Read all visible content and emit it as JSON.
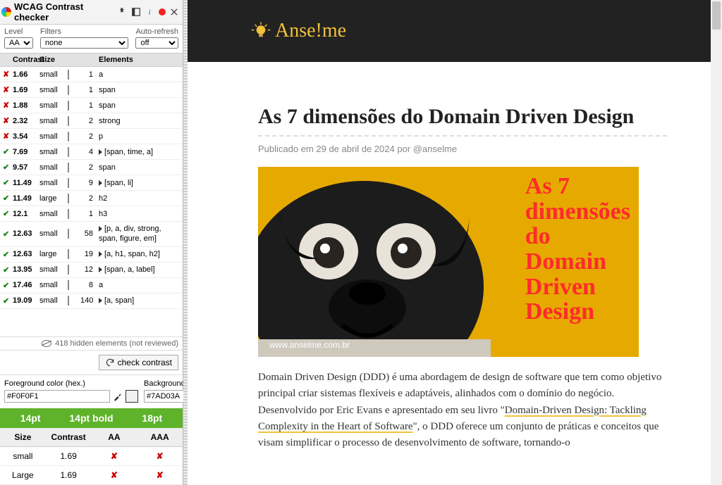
{
  "panel": {
    "title": "WCAG Contrast checker",
    "filters": {
      "level_label": "Level",
      "level_value": "AA",
      "filters_label": "Filters",
      "filters_value": "none",
      "autorefresh_label": "Auto-refresh",
      "autorefresh_value": "off"
    },
    "columns": {
      "contrast": "Contrast",
      "size": "Size",
      "elements": "Elements"
    },
    "rows": [
      {
        "pass": false,
        "contrast": "1.66",
        "size": "small",
        "swatch": "#2b2b2b",
        "count": "1",
        "expand": false,
        "elems": "a"
      },
      {
        "pass": false,
        "contrast": "1.69",
        "size": "small",
        "swatch": "#7ad03a",
        "count": "1",
        "expand": false,
        "elems": "span"
      },
      {
        "pass": false,
        "contrast": "1.88",
        "size": "small",
        "swatch": "#2b2b2b",
        "count": "1",
        "expand": false,
        "elems": "span"
      },
      {
        "pass": false,
        "contrast": "2.32",
        "size": "small",
        "swatch": "#bfbfbf",
        "count": "2",
        "expand": false,
        "elems": "strong"
      },
      {
        "pass": false,
        "contrast": "3.54",
        "size": "small",
        "swatch": "#bfbfbf",
        "count": "2",
        "expand": false,
        "elems": "p"
      },
      {
        "pass": true,
        "contrast": "7.69",
        "size": "small",
        "swatch": "#2b2b2b",
        "count": "4",
        "expand": true,
        "elems": "[span, time, a]"
      },
      {
        "pass": true,
        "contrast": "9.57",
        "size": "small",
        "swatch": "#2b2b2b",
        "count": "2",
        "expand": false,
        "elems": "span"
      },
      {
        "pass": true,
        "contrast": "11.49",
        "size": "small",
        "swatch": "#2b2b2b",
        "count": "9",
        "expand": true,
        "elems": "[span, li]"
      },
      {
        "pass": true,
        "contrast": "11.49",
        "size": "large",
        "swatch": "#2b2b2b",
        "count": "2",
        "expand": false,
        "elems": "h2"
      },
      {
        "pass": true,
        "contrast": "12.1",
        "size": "small",
        "swatch": "#2b2b2b",
        "count": "1",
        "expand": false,
        "elems": "h3"
      },
      {
        "pass": true,
        "contrast": "12.63",
        "size": "small",
        "swatch": "#1a1a1a",
        "count": "58",
        "expand": true,
        "elems": "[p, a, div, strong, span, figure, em]"
      },
      {
        "pass": true,
        "contrast": "12.63",
        "size": "large",
        "swatch": "#1a1a1a",
        "count": "19",
        "expand": true,
        "elems": "[a, h1, span, h2]"
      },
      {
        "pass": true,
        "contrast": "13.95",
        "size": "small",
        "swatch": "#1a1a1a",
        "count": "12",
        "expand": true,
        "elems": "[span, a, label]"
      },
      {
        "pass": true,
        "contrast": "17.46",
        "size": "small",
        "swatch": "#1a1a1a",
        "count": "8",
        "expand": false,
        "elems": "a"
      },
      {
        "pass": true,
        "contrast": "19.09",
        "size": "small",
        "swatch": "#000000",
        "count": "140",
        "expand": true,
        "elems": "[a, span]"
      }
    ],
    "hidden_note": "418 hidden elements (not reviewed)",
    "check_btn": "check contrast",
    "fg_label": "Foreground color (hex.)",
    "bg_label": "Background color (hex.)",
    "fg_value": "#F0F0F1",
    "bg_value": "#7AD03A",
    "fg_swatch": "#F0F0F1",
    "bg_swatch": "#7AD03A",
    "ptbar": {
      "a": "14pt",
      "b": "14pt bold",
      "c": "18pt"
    },
    "result_head": {
      "size": "Size",
      "contrast": "Contrast",
      "aa": "AA",
      "aaa": "AAA"
    },
    "results": [
      {
        "size": "small",
        "contrast": "1.69",
        "aa": "✘",
        "aaa": "✘"
      },
      {
        "size": "Large",
        "contrast": "1.69",
        "aa": "✘",
        "aaa": "✘"
      }
    ]
  },
  "site": {
    "brand": "Anse!me",
    "article_title": "As 7 dimensões do Domain Driven Design",
    "meta_prefix": "Publicado em ",
    "meta_date": "29 de abril de 2024",
    "meta_by": " por ",
    "meta_author": "@anselme",
    "hero_lines": "As 7\ndimensões\ndo\nDomain\nDriven\nDesign",
    "hero_url": "www.anselme.com.br",
    "body_before": "Domain Driven Design (DDD) é uma abordagem de design de software que tem como objetivo principal criar sistemas flexíveis e adaptáveis, alinhados com o domínio do negócio. Desenvolvido por Eric Evans e apresentado em seu livro \"",
    "body_link": "Domain-Driven Design: Tackling Complexity in the Heart of Software",
    "body_after": "\", o DDD oferece um conjunto de práticas e conceitos que visam simplificar o processo de desenvolvimento de software, tornando-o"
  }
}
